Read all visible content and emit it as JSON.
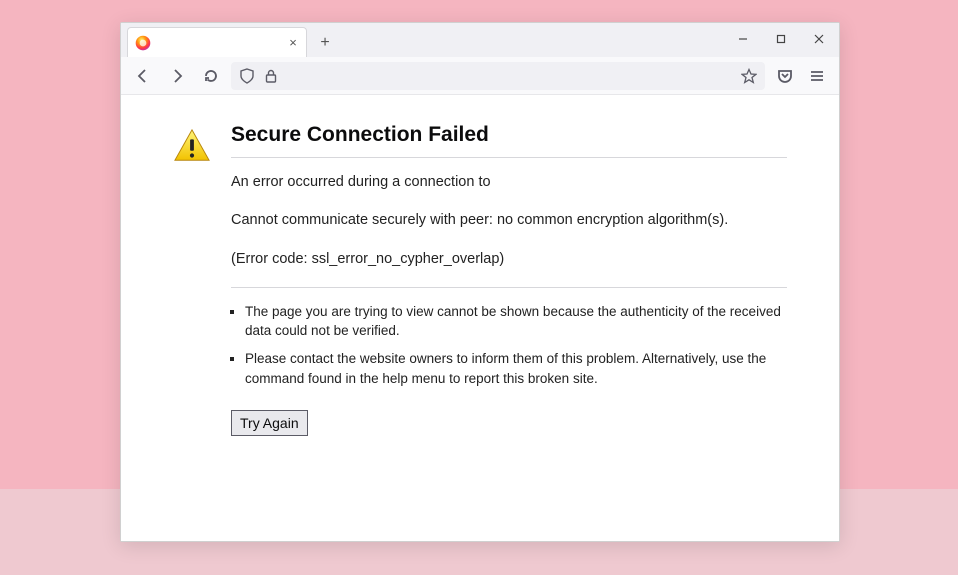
{
  "tab": {
    "title": "",
    "close_glyph": "×",
    "newtab_glyph": "+"
  },
  "urlbar": {
    "value": ""
  },
  "error": {
    "title": "Secure Connection Failed",
    "line1": "An error occurred during a connection to",
    "line2": "Cannot communicate securely with peer: no common encryption algorithm(s).",
    "code": "(Error code: ssl_error_no_cypher_overlap)",
    "bullets": [
      "The page you are trying to view cannot be shown because the authenticity of the received data could not be verified.",
      "Please contact the website owners to inform them of this problem. Alternatively, use the command found in the help menu to report this broken site."
    ],
    "try_again_label": "Try Again"
  }
}
